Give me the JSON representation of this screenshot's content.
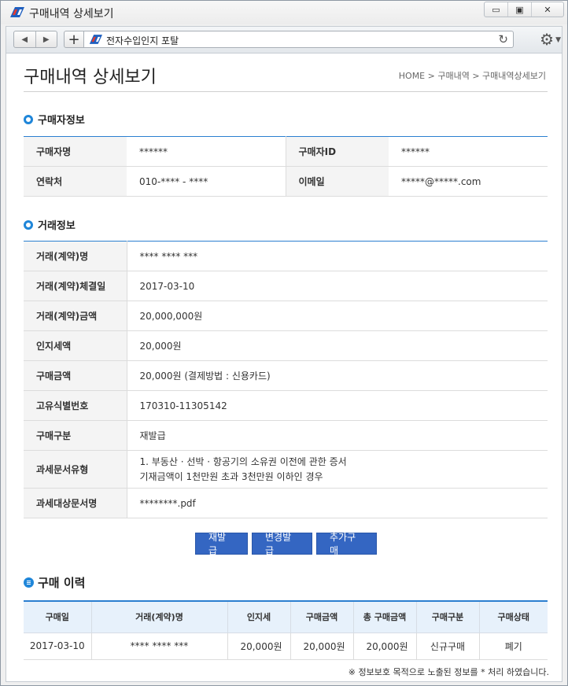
{
  "window": {
    "title": "구매내역 상세보기",
    "buttons": [
      "▭",
      "▣",
      "✕"
    ]
  },
  "browser": {
    "url_text": "전자수입인지 포탈",
    "back": "◀",
    "forward": "▶",
    "add_tab": "+",
    "reload": "↻",
    "settings": "⚙"
  },
  "header": {
    "title": "구매내역 상세보기",
    "breadcrumb": "HOME > 구매내역 > 구매내역상세보기"
  },
  "buyer": {
    "heading": "구매자정보",
    "name_label": "구매자명",
    "name_value": "******",
    "id_label": "구매자ID",
    "id_value": "******",
    "phone_label": "연락처",
    "phone_value": "010-**** - ****",
    "email_label": "이메일",
    "email_value": "*****@*****.com"
  },
  "trade": {
    "heading": "거래정보",
    "rows": [
      {
        "label": "거래(계약)명",
        "value": "**** **** ***"
      },
      {
        "label": "거래(계약)체결일",
        "value": "2017-03-10"
      },
      {
        "label": "거래(계약)금액",
        "value": "20,000,000원"
      },
      {
        "label": "인지세액",
        "value": "20,000원"
      },
      {
        "label": "구매금액",
        "value": "20,000원 (결제방법 : 신용카드)"
      },
      {
        "label": "고유식별번호",
        "value": "170310-11305142"
      },
      {
        "label": "구매구분",
        "value": "재발급"
      },
      {
        "label": "과세문서유형",
        "value": "1. 부동산 · 선박 · 항공기의 소유권 이전에 관한 증서",
        "value2": "기재금액이 1천만원 초과 3천만원 이하인 경우"
      },
      {
        "label": "과세대상문서명",
        "value": "********.pdf"
      }
    ]
  },
  "actions": {
    "reissue": "재발급",
    "change_issue": "변경발급",
    "add_purchase": "추가구매"
  },
  "history": {
    "heading": "구매 이력",
    "columns": [
      "구매일",
      "거래(계약)명",
      "인지세",
      "구매금액",
      "총 구매금액",
      "구매구분",
      "구매상태"
    ],
    "rows": [
      [
        "2017-03-10",
        "**** **** ***",
        "20,000원",
        "20,000원",
        "20,000원",
        "신규구매",
        "폐기"
      ]
    ]
  },
  "note": "※ 정보보호 목적으로 노출된 정보를 * 처리 하였습니다.",
  "colors": {
    "accent": "#1f86d9",
    "button": "#3466c2",
    "table_header": "#e7f1fb"
  }
}
